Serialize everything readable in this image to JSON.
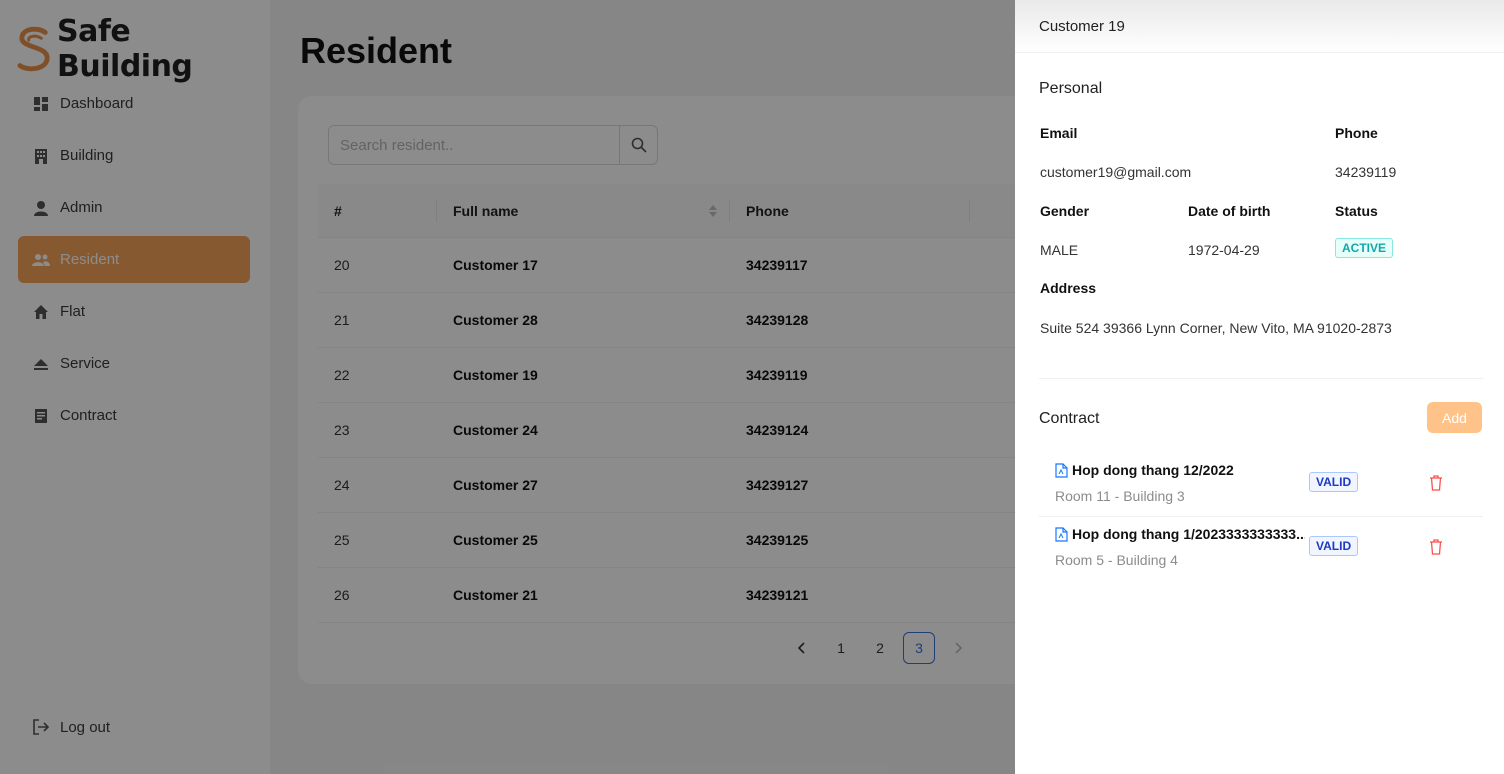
{
  "app": {
    "brand": "Safe Building"
  },
  "sidebar": {
    "items": [
      {
        "label": "Dashboard",
        "icon": "dashboard-icon"
      },
      {
        "label": "Building",
        "icon": "building-icon"
      },
      {
        "label": "Admin",
        "icon": "user-icon"
      },
      {
        "label": "Resident",
        "icon": "team-icon",
        "active": true
      },
      {
        "label": "Flat",
        "icon": "home-icon"
      },
      {
        "label": "Service",
        "icon": "eject-icon"
      },
      {
        "label": "Contract",
        "icon": "file-text-icon"
      }
    ],
    "logout": "Log out"
  },
  "main": {
    "title": "Resident",
    "search": {
      "placeholder": "Search resident.."
    },
    "table": {
      "headers": [
        "#",
        "Full name",
        "Phone"
      ],
      "rows": [
        {
          "no": "20",
          "name": "Customer 17",
          "phone": "34239117"
        },
        {
          "no": "21",
          "name": "Customer 28",
          "phone": "34239128"
        },
        {
          "no": "22",
          "name": "Customer 19",
          "phone": "34239119"
        },
        {
          "no": "23",
          "name": "Customer 24",
          "phone": "34239124"
        },
        {
          "no": "24",
          "name": "Customer 27",
          "phone": "34239127"
        },
        {
          "no": "25",
          "name": "Customer 25",
          "phone": "34239125"
        },
        {
          "no": "26",
          "name": "Customer 21",
          "phone": "34239121"
        }
      ]
    },
    "pagination": {
      "pages": [
        "1",
        "2",
        "3"
      ],
      "current": "3",
      "prev": "‹",
      "next": "›"
    }
  },
  "drawer": {
    "title": "Customer 19",
    "personal": {
      "section": "Personal",
      "email_label": "Email",
      "email": "customer19@gmail.com",
      "phone_label": "Phone",
      "phone": "34239119",
      "gender_label": "Gender",
      "gender": "MALE",
      "dob_label": "Date of birth",
      "dob": "1972-04-29",
      "status_label": "Status",
      "status": "ACTIVE",
      "address_label": "Address",
      "address": "Suite 524 39366 Lynn Corner, New Vito, MA 91020-2873"
    },
    "contract": {
      "section": "Contract",
      "add_label": "Add",
      "items": [
        {
          "title": "Hop dong thang 12/2022",
          "room": "Room 11 - Building 3",
          "status": "VALID"
        },
        {
          "title": "Hop dong thang 1/2023333333333...",
          "room": "Room 5 - Building 4",
          "status": "VALID"
        }
      ]
    }
  },
  "colors": {
    "accent": "#f5a35a",
    "active_tag": "#13a8a8",
    "valid_tag": "#1d39c4",
    "danger": "#ff4d4f",
    "pager_active": "#3b6fd6"
  }
}
